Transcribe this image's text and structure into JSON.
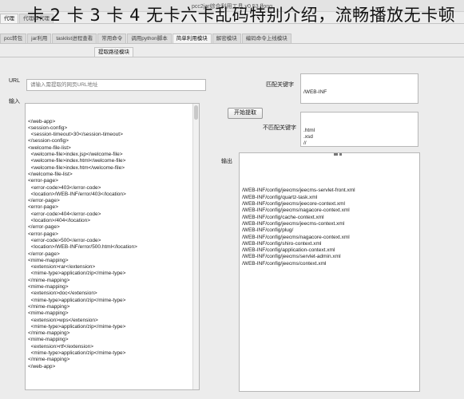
{
  "window": {
    "title": "pcc2jar综合利用工具 v0.53 ffong"
  },
  "tabs_row1": [
    "代理",
    "代理ip/代理"
  ],
  "tabs_row2": [
    "pcc转包",
    "jar利用",
    "tasklist进程查看",
    "常用命令",
    "调用python脚本",
    "简单利用模块",
    "解密模块",
    "编码命令上线模块"
  ],
  "tabs_row3": [
    "提取路径模块"
  ],
  "overlay_text": "卡 2 卡 3 卡 4 无卡六卡乱码特别介绍，流畅播放无卡顿",
  "url": {
    "label": "URL",
    "placeholder": "请输入需提取的网页URL地址"
  },
  "input": {
    "label": "输入",
    "lines": [
      "</web-app>",
      "<session-config>",
      "  <session-timeout>30</session-timeout>",
      "</session-config>",
      "<welcome-file-list>",
      "  <welcome-file>index.jsp</welcome-file>",
      "  <welcome-file>index.html</welcome-file>",
      "  <welcome-file>index.htm</welcome-file>",
      "</welcome-file-list>",
      "<error-page>",
      "  <error-code>403</error-code>",
      "  <location>/WEB-INF/error/403</location>",
      "</error-page>",
      "<error-page>",
      "  <error-code>404</error-code>",
      "  <location>/404</location>",
      "</error-page>",
      "<error-page>",
      "  <error-code>500</error-code>",
      "  <location>/WEB-INF/error/500.html</location>",
      "</error-page>",
      "<mime-mapping>",
      "  <extension>rar</extension>",
      "  <mime-type>application/zip</mime-type>",
      "</mime-mapping>",
      "<mime-mapping>",
      "  <extension>doc</extension>",
      "  <mime-type>application/zip</mime-type>",
      "</mime-mapping>",
      "<mime-mapping>",
      "  <extension>wps</extension>",
      "  <mime-type>application/zip</mime-type>",
      "</mime-mapping>",
      "<mime-mapping>",
      "  <extension>rtf</extension>",
      "  <mime-type>application/zip</mime-type>",
      "</mime-mapping>",
      "</web-app>"
    ]
  },
  "match_keyword": {
    "label": "匹配关键字",
    "value": "/WEB-INF"
  },
  "extract_button": {
    "label": "开始提取"
  },
  "exclude_keyword": {
    "label": "不匹配关键字",
    "lines": [
      ".html",
      ".xsd",
      "//"
    ]
  },
  "output": {
    "label": "输出",
    "lines": [
      "/WEB-INF/config/jeecms/jeecms-servlet-front.xml",
      "/WEB-INF/config/quartz-task.xml",
      "/WEB-INF/config/jeecms/jeecore-context.xml",
      "/WEB-INF/config/jeecms/nagacore-context.xml",
      "/WEB-INF/config/cache-context.xml",
      "/WEB-INF/config/jeecms/jeecms-context.xml",
      "/WEB-INF/config/plug/",
      "/WEB-INF/config/jeecms/nagacore-context.xml",
      "/WEB-INF/config/shiro-context.xml",
      "/WEB-INF/config/application-context.xml",
      "/WEB-INF/config/jeecms/servlet-admin.xml",
      "/WEB-INF/config/jeecms/context.xml"
    ]
  }
}
